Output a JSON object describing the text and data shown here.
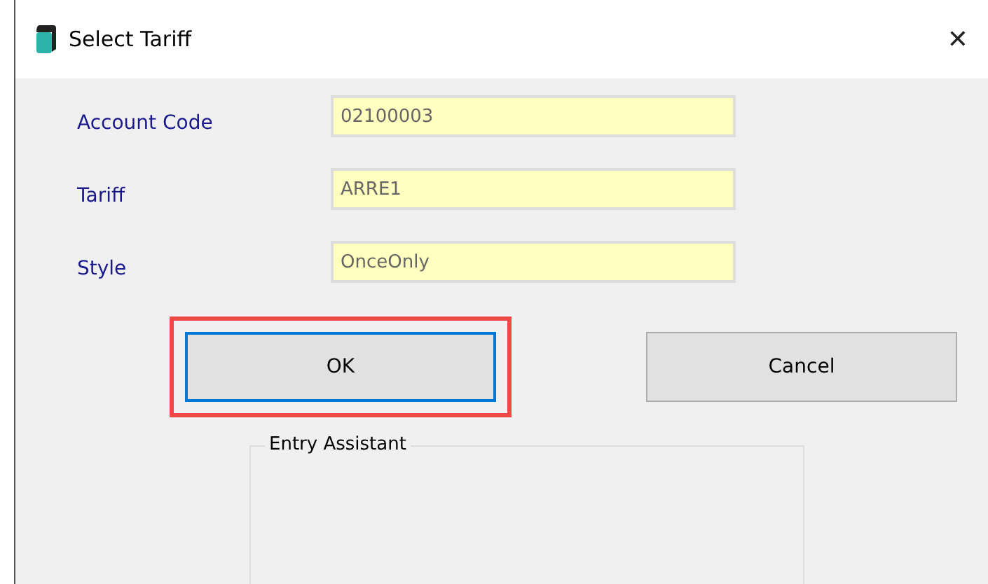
{
  "window": {
    "title": "Select Tariff",
    "close": "✕"
  },
  "fields": [
    {
      "label": "Account Code",
      "value": "02100003"
    },
    {
      "label": "Tariff",
      "value": "ARRE1"
    },
    {
      "label": "Style",
      "value": "OnceOnly"
    }
  ],
  "buttons": [
    {
      "label": "OK",
      "focused": true,
      "highlighted": true
    },
    {
      "label": "Cancel",
      "focused": false,
      "highlighted": false
    }
  ],
  "group": {
    "title": "Entry Assistant"
  }
}
